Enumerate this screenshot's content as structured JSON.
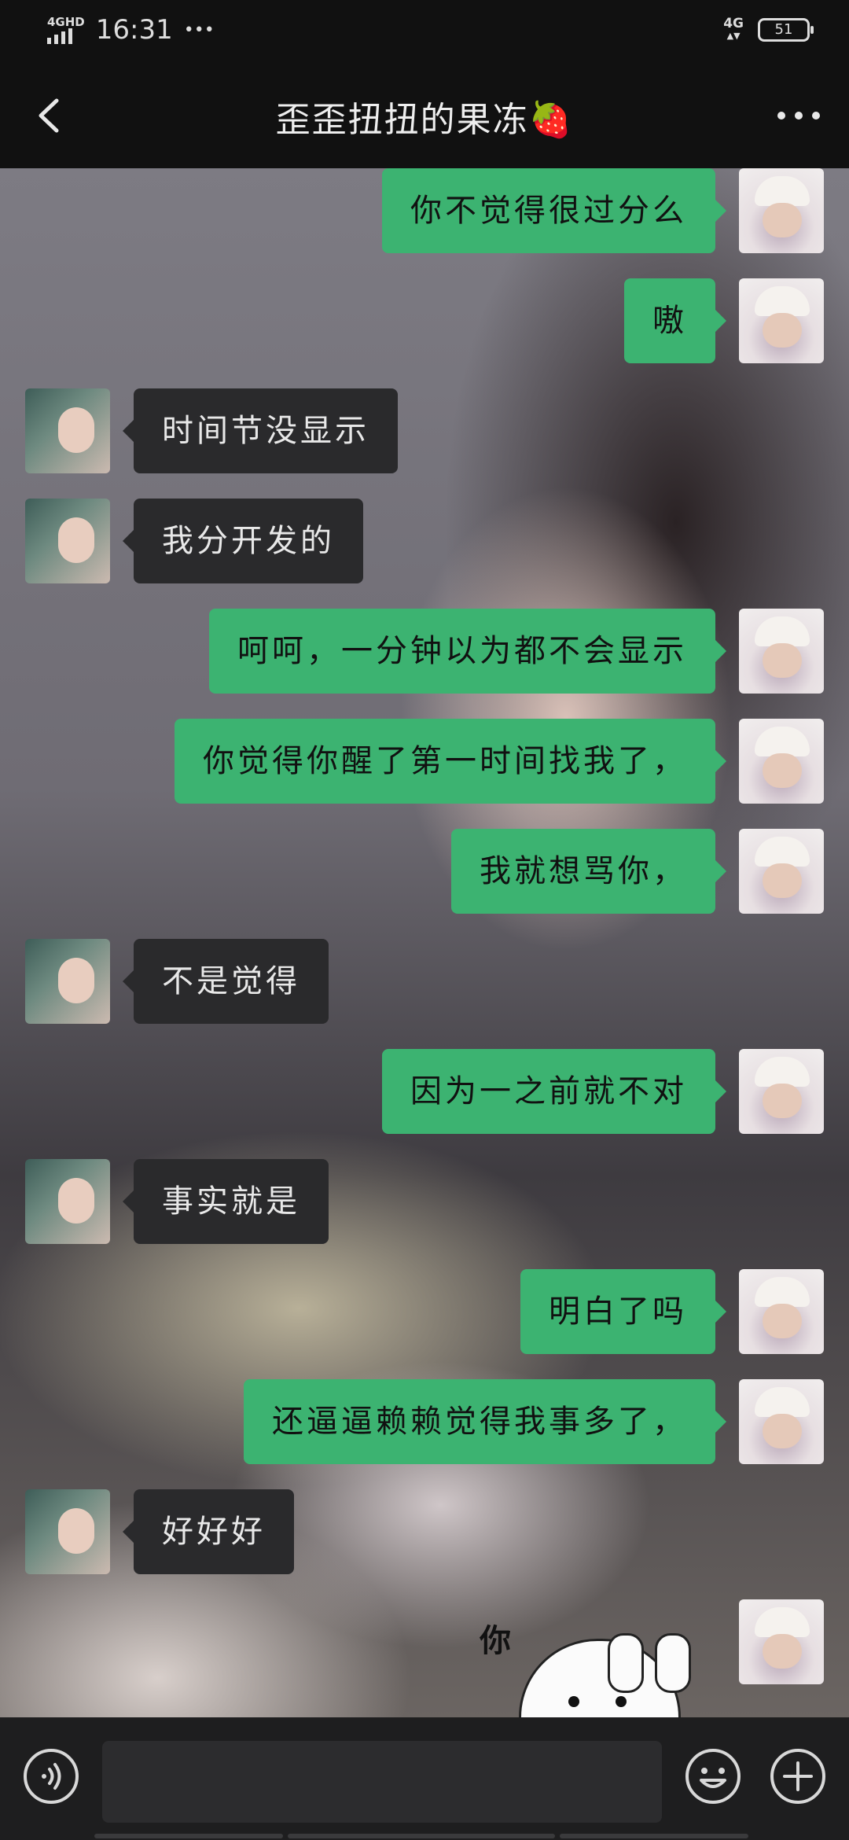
{
  "status_bar": {
    "network_type": "4GHD",
    "time": "16:31",
    "dots": "•••",
    "network_right": "4G",
    "battery": "51"
  },
  "header": {
    "title": "歪歪扭扭的果冻🍓",
    "back_icon": "chevron-left-icon",
    "more_icon": "more-dots-icon"
  },
  "messages": [
    {
      "from": "me",
      "text": "你不觉得很过分么"
    },
    {
      "from": "me",
      "text": "嗷"
    },
    {
      "from": "other",
      "text": "时间节没显示"
    },
    {
      "from": "other",
      "text": "我分开发的"
    },
    {
      "from": "me",
      "text": "呵呵，一分钟以为都不会显示"
    },
    {
      "from": "me",
      "text": "你觉得你醒了第一时间找我了，"
    },
    {
      "from": "me",
      "text": "我就想骂你，"
    },
    {
      "from": "other",
      "text": "不是觉得"
    },
    {
      "from": "me",
      "text": "因为一之前就不对"
    },
    {
      "from": "other",
      "text": "事实就是"
    },
    {
      "from": "me",
      "text": "明白了吗"
    },
    {
      "from": "me",
      "text": "还逼逼赖赖觉得我事多了，"
    },
    {
      "from": "other",
      "text": "好好好"
    }
  ],
  "sticker": {
    "text": "你"
  },
  "input_bar": {
    "voice_icon": "voice-icon",
    "input_value": "",
    "emoji_icon": "emoji-icon",
    "plus_icon": "plus-icon"
  }
}
